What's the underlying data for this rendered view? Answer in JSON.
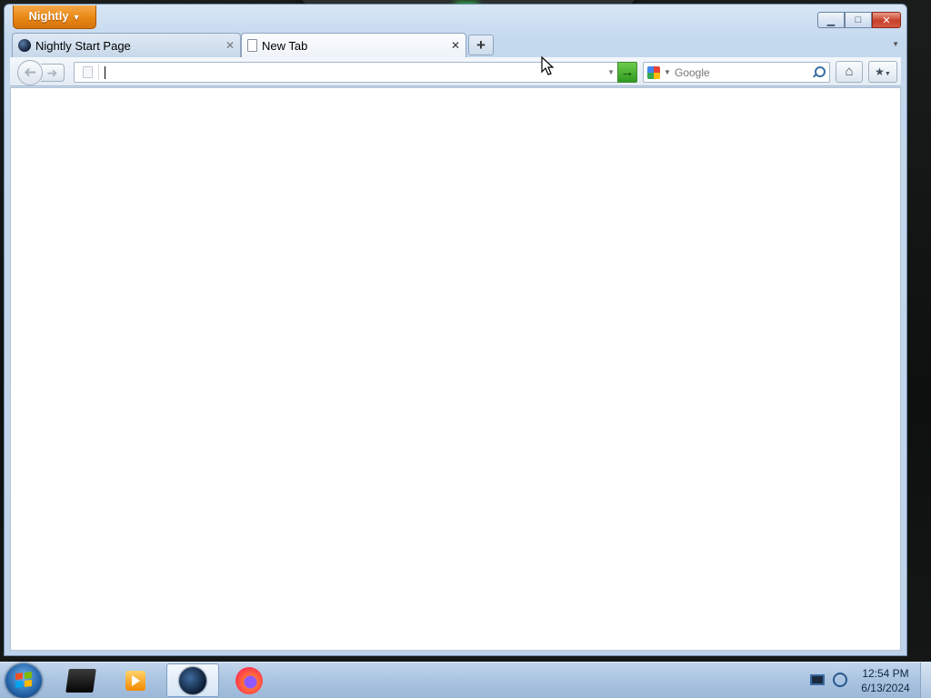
{
  "window": {
    "app_button_label": "Nightly",
    "controls": {
      "minimize": "▁",
      "maximize": "□",
      "close": "✕"
    }
  },
  "tabs": [
    {
      "label": "Nightly Start Page",
      "icon": "nightly-globe-icon",
      "active": false
    },
    {
      "label": "New Tab",
      "icon": "blank-page-icon",
      "active": true
    }
  ],
  "toolbar": {
    "url_value": "",
    "search_placeholder": "Google",
    "search_engine_icon": "google-icon",
    "new_tab_symbol": "+",
    "go_symbol": "→",
    "home_icon": "⌂",
    "bookmarks_icon": "★"
  },
  "taskbar": {
    "items": [
      "terminal-icon",
      "media-player-icon",
      "nightly-icon",
      "firefox-icon"
    ],
    "active_item": "nightly-icon",
    "clock_time": "12:54 PM",
    "clock_date": "6/13/2024"
  },
  "colors": {
    "app_button": "#ea8a17",
    "go_button": "#2e9a20",
    "close_button": "#c7402a"
  }
}
